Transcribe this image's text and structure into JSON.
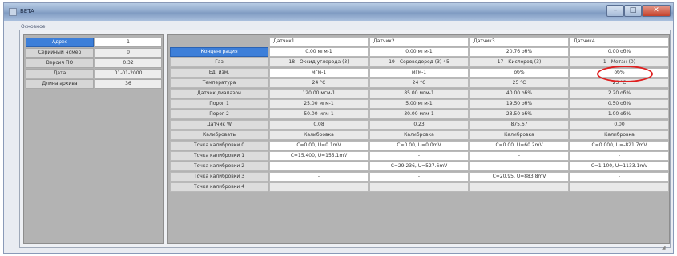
{
  "window": {
    "title": "BETA"
  },
  "group": {
    "label": "Основное"
  },
  "left_panel": {
    "rows": [
      {
        "key": "Адрес",
        "value": "1",
        "selected": true
      },
      {
        "key": "Серийный номер",
        "value": "0"
      },
      {
        "key": "Версия ПО",
        "value": "0.32"
      },
      {
        "key": "Дата",
        "value": "01-01-2000"
      },
      {
        "key": "Длина архива",
        "value": "36"
      }
    ]
  },
  "grid": {
    "columns": [
      "Датчик1",
      "Датчик2",
      "Датчик3",
      "Датчик4"
    ],
    "rows": [
      {
        "label": "Концентрация",
        "selected": true,
        "values": [
          "0.00 мгм-1",
          "0.00 мгм-1",
          "20.76 об%",
          "0.00 об%"
        ]
      },
      {
        "label": "Газ",
        "values": [
          "18 - Оксид углерода (3)",
          "19 - Сероводород (3) 45",
          "17 - Кислород (3)",
          "1 - Метан (0)"
        ]
      },
      {
        "label": "Ед. изм.",
        "values": [
          "мгм-1",
          "мгм-1",
          "об%",
          "об%"
        ]
      },
      {
        "label": "Температура",
        "values": [
          "24 °C",
          "24 °C",
          "25 °C",
          "25 °C"
        ]
      },
      {
        "label": "Датчик диапазон",
        "values": [
          "120.00 мгм-1",
          "85.00 мгм-1",
          "40.00 об%",
          "2.20 об%"
        ]
      },
      {
        "label": "Порог 1",
        "values": [
          "25.00 мгм-1",
          "5.00 мгм-1",
          "19.50 об%",
          "0.50 об%"
        ]
      },
      {
        "label": "Порог 2",
        "values": [
          "50.00 мгм-1",
          "30.00 мгм-1",
          "23.50 об%",
          "1.00 об%"
        ]
      },
      {
        "label": "Датчик W",
        "values": [
          "0.08",
          "0.23",
          "875.67",
          "0.00"
        ]
      },
      {
        "label": "Калибровать",
        "values": [
          "Калибровка",
          "Калибровка",
          "Калибровка",
          "Калибровка"
        ]
      },
      {
        "label": "Точка калибровки 0",
        "values": [
          "C=0.00, U=0.1mV",
          "C=0.00, U=0.0mV",
          "C=0.00, U=60.2mV",
          "C=0.000, U=-821.7mV"
        ]
      },
      {
        "label": "Точка калибровки 1",
        "values": [
          "C=15.400, U=155.1mV",
          "-",
          "-",
          "-"
        ]
      },
      {
        "label": "Точка калибровки 2",
        "values": [
          "-",
          "C=29.236, U=527.6mV",
          "-",
          "C=1.100, U=1133.1mV"
        ]
      },
      {
        "label": "Точка калибровки 3",
        "values": [
          "-",
          "-",
          "C=20.95, U=883.8mV",
          "-"
        ]
      },
      {
        "label": "Точка калибровки 4",
        "values": [
          "",
          "",
          "",
          ""
        ]
      }
    ]
  }
}
